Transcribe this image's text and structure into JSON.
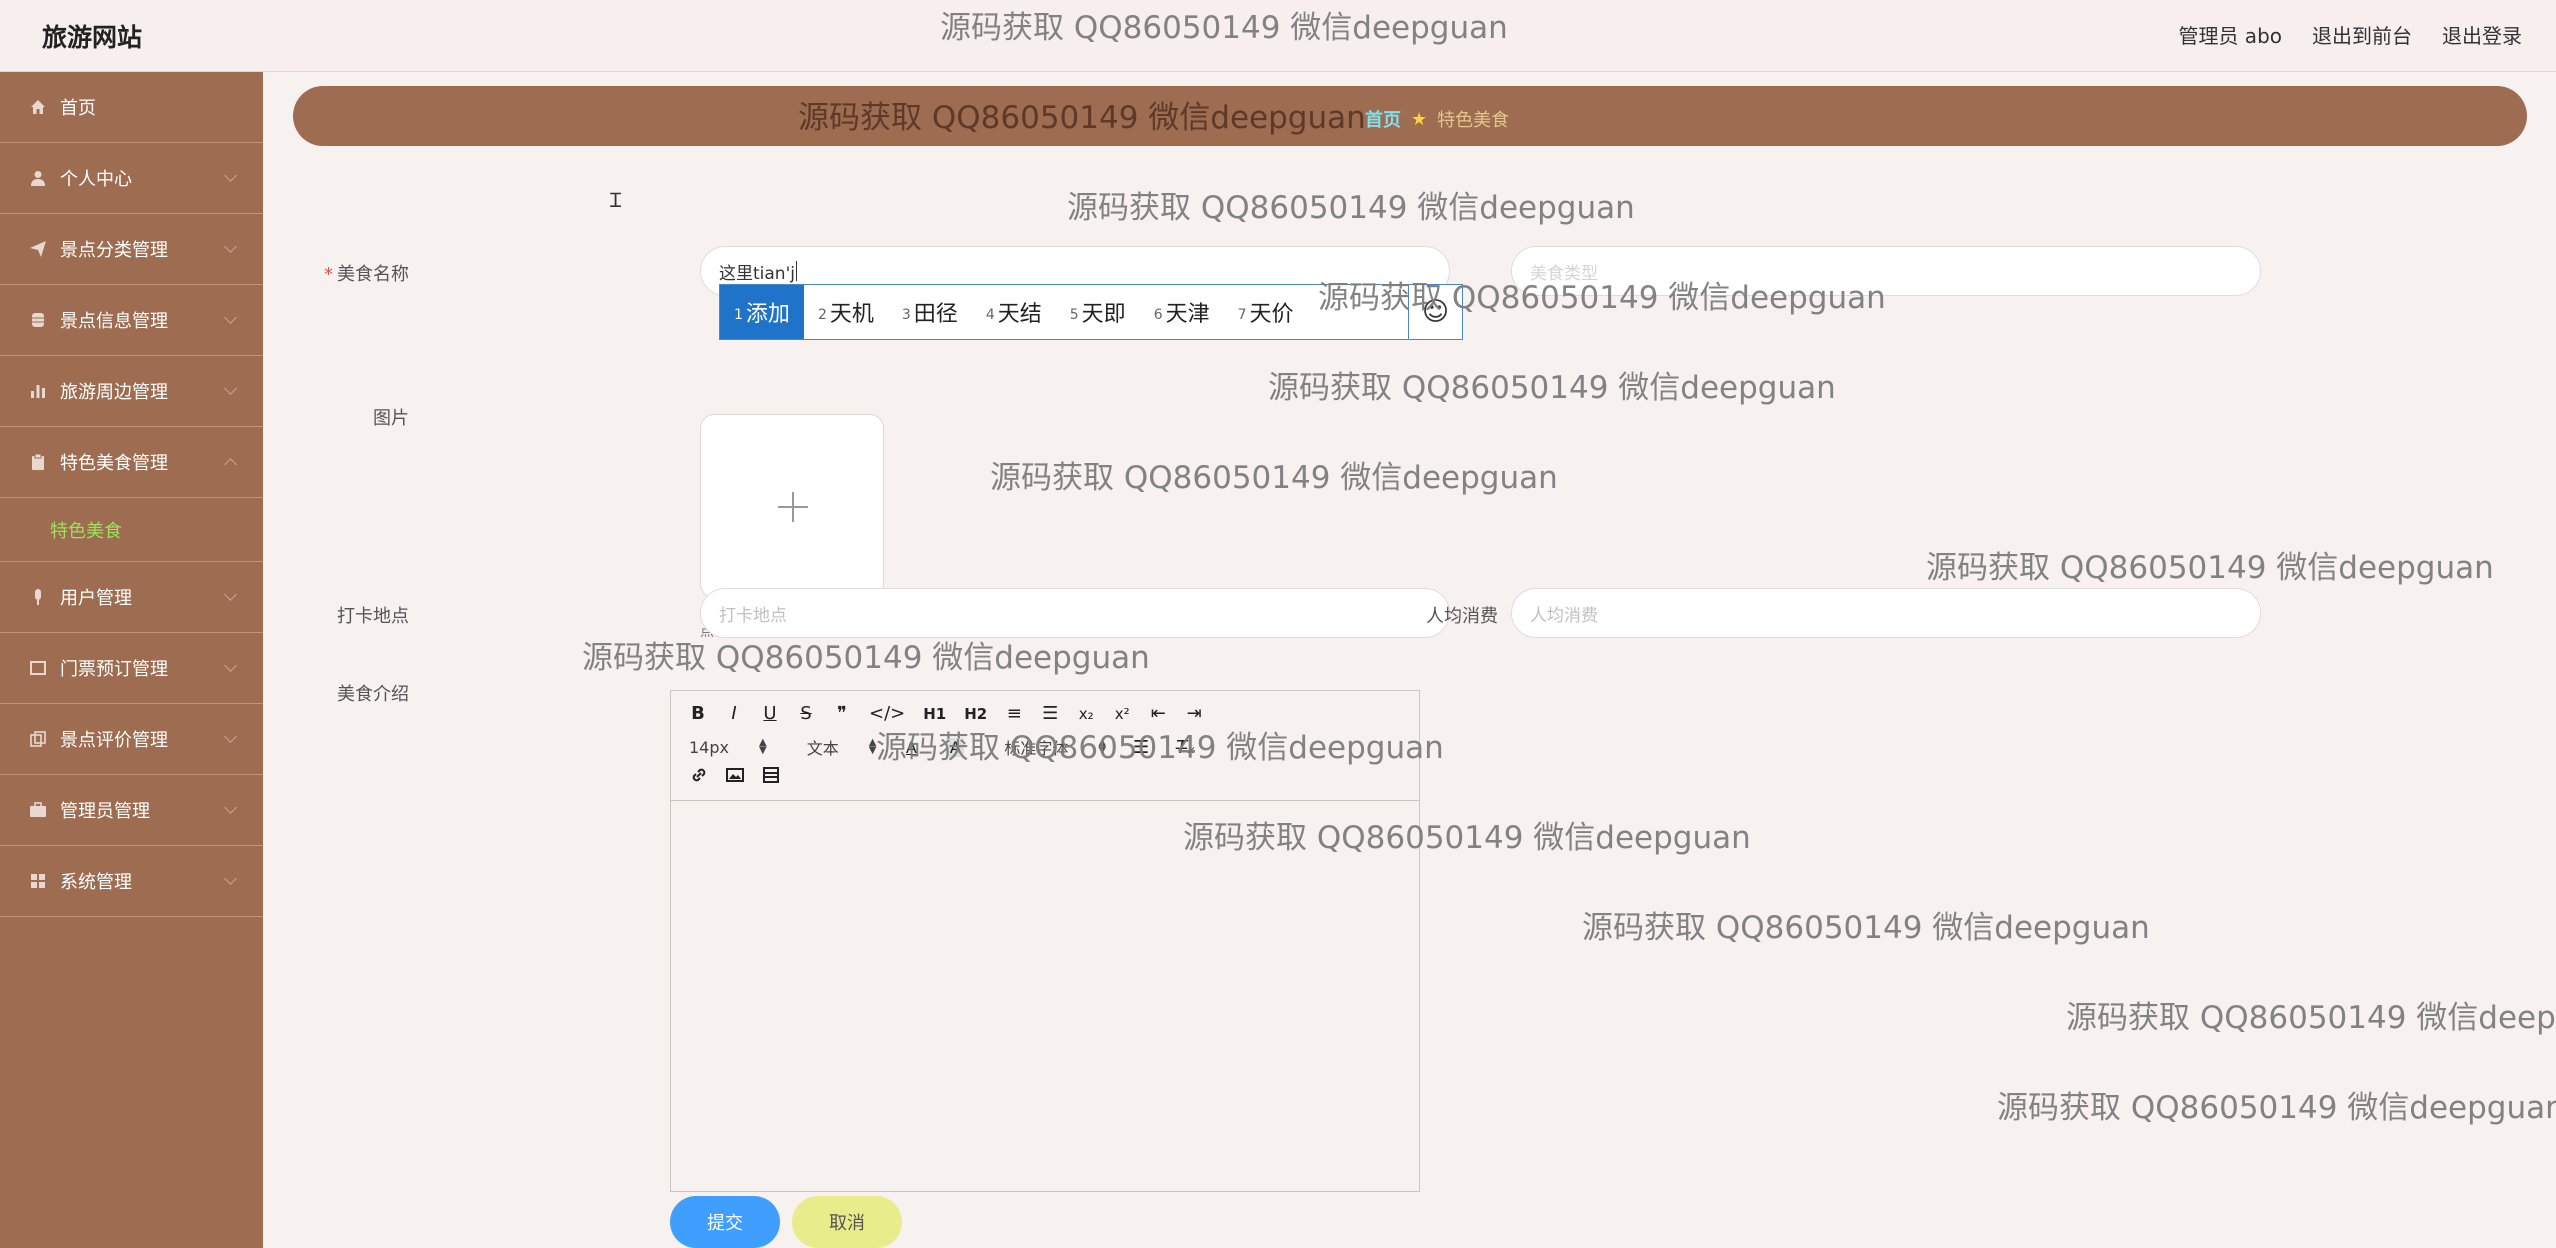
{
  "header": {
    "brand": "旅游网站",
    "links": [
      "管理员 abo",
      "退出到前台",
      "退出登录"
    ]
  },
  "sidebar": {
    "items": [
      {
        "label": "首页",
        "icon": "home-icon"
      },
      {
        "label": "个人中心",
        "icon": "user-icon"
      },
      {
        "label": "景点分类管理",
        "icon": "send-icon"
      },
      {
        "label": "景点信息管理",
        "icon": "database-icon"
      },
      {
        "label": "旅游周边管理",
        "icon": "bar-chart-icon"
      },
      {
        "label": "特色美食管理",
        "icon": "clipboard-icon"
      },
      {
        "label": "用户管理",
        "icon": "mic-icon"
      },
      {
        "label": "门票预订管理",
        "icon": "ticket-icon"
      },
      {
        "label": "景点评价管理",
        "icon": "copy-icon"
      },
      {
        "label": "管理员管理",
        "icon": "briefcase-icon"
      },
      {
        "label": "系统管理",
        "icon": "grid-icon"
      }
    ],
    "submenu": {
      "label": "特色美食"
    }
  },
  "breadcrumb": {
    "home": "首页",
    "current": "特色美食"
  },
  "form": {
    "food_name_label": "美食名称",
    "food_name_value": "这里tian'j",
    "right_top_placeholder": "美食类型",
    "image_label": "图片",
    "upload_tip": "点击上传图片",
    "checkin_label": "打卡地点",
    "checkin_placeholder": "打卡地点",
    "avg_cost_label": "人均消费",
    "avg_cost_placeholder": "人均消费",
    "intro_label": "美食介绍",
    "submit": "提交",
    "cancel": "取消"
  },
  "ime": {
    "candidates": [
      {
        "num": "1",
        "text": "添加"
      },
      {
        "num": "2",
        "text": "天机"
      },
      {
        "num": "3",
        "text": "田径"
      },
      {
        "num": "4",
        "text": "天结"
      },
      {
        "num": "5",
        "text": "天即"
      },
      {
        "num": "6",
        "text": "天津"
      },
      {
        "num": "7",
        "text": "天价"
      }
    ],
    "emoji": "☺"
  },
  "editor": {
    "font_size": "14px",
    "text_type": "文本",
    "font_family": "标准字体"
  },
  "watermark": "源码获取 QQ86050149 微信deepguan"
}
